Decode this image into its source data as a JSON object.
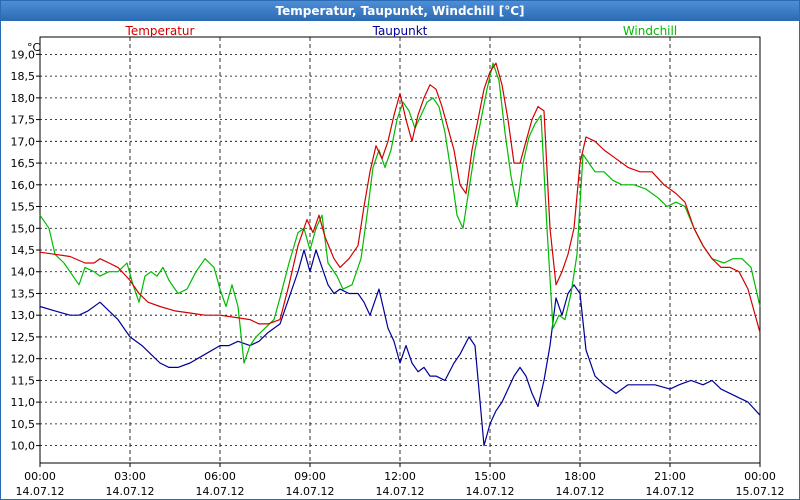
{
  "window": {
    "title": "Temperatur, Taupunkt, Windchill [°C]"
  },
  "chart_data": {
    "type": "line",
    "title": "Temperatur, Taupunkt, Windchill [°C]",
    "ylabel": "°C",
    "xlabel": "",
    "ylim": [
      9.6,
      19.4
    ],
    "xlim": [
      0,
      24
    ],
    "grid": true,
    "legend_position": "top",
    "y_ticks": [
      "10,0",
      "10,5",
      "11,0",
      "11,5",
      "12,0",
      "12,5",
      "13,0",
      "13,5",
      "14,0",
      "14,5",
      "15,0",
      "15,5",
      "16,0",
      "16,5",
      "17,0",
      "17,5",
      "18,0",
      "18,5",
      "19,0"
    ],
    "x_ticks": [
      {
        "time": "00:00",
        "date": "14.07.12"
      },
      {
        "time": "03:00",
        "date": "14.07.12"
      },
      {
        "time": "06:00",
        "date": "14.07.12"
      },
      {
        "time": "09:00",
        "date": "14.07.12"
      },
      {
        "time": "12:00",
        "date": "14.07.12"
      },
      {
        "time": "15:00",
        "date": "14.07.12"
      },
      {
        "time": "18:00",
        "date": "14.07.12"
      },
      {
        "time": "21:00",
        "date": "14.07.12"
      },
      {
        "time": "00:00",
        "date": "15.07.12"
      }
    ],
    "x_unit_note": "x values are hours since 14.07.12 00:00",
    "series": [
      {
        "name": "Temperatur",
        "color": "#d40000",
        "points": [
          [
            0,
            14.45
          ],
          [
            0.5,
            14.4
          ],
          [
            1,
            14.35
          ],
          [
            1.5,
            14.2
          ],
          [
            1.8,
            14.2
          ],
          [
            2,
            14.3
          ],
          [
            2.3,
            14.2
          ],
          [
            2.6,
            14.1
          ],
          [
            3,
            13.8
          ],
          [
            3.3,
            13.5
          ],
          [
            3.6,
            13.3
          ],
          [
            4,
            13.2
          ],
          [
            4.5,
            13.1
          ],
          [
            5,
            13.05
          ],
          [
            5.5,
            13.0
          ],
          [
            6,
            13.0
          ],
          [
            6.5,
            12.95
          ],
          [
            7,
            12.9
          ],
          [
            7.3,
            12.8
          ],
          [
            7.6,
            12.8
          ],
          [
            8,
            12.9
          ],
          [
            8.3,
            13.7
          ],
          [
            8.6,
            14.6
          ],
          [
            8.9,
            15.2
          ],
          [
            9.1,
            14.9
          ],
          [
            9.3,
            15.3
          ],
          [
            9.5,
            14.8
          ],
          [
            9.8,
            14.3
          ],
          [
            10,
            14.1
          ],
          [
            10.3,
            14.3
          ],
          [
            10.6,
            14.6
          ],
          [
            10.8,
            15.5
          ],
          [
            11,
            16.3
          ],
          [
            11.2,
            16.9
          ],
          [
            11.4,
            16.6
          ],
          [
            11.6,
            17.0
          ],
          [
            11.8,
            17.6
          ],
          [
            12,
            18.1
          ],
          [
            12.2,
            17.5
          ],
          [
            12.4,
            17.0
          ],
          [
            12.6,
            17.6
          ],
          [
            12.8,
            18.0
          ],
          [
            13,
            18.3
          ],
          [
            13.2,
            18.2
          ],
          [
            13.4,
            17.8
          ],
          [
            13.6,
            17.3
          ],
          [
            13.8,
            16.8
          ],
          [
            14,
            16.0
          ],
          [
            14.2,
            15.8
          ],
          [
            14.4,
            16.8
          ],
          [
            14.6,
            17.5
          ],
          [
            14.8,
            18.2
          ],
          [
            15,
            18.6
          ],
          [
            15.2,
            18.8
          ],
          [
            15.4,
            18.3
          ],
          [
            15.6,
            17.5
          ],
          [
            15.8,
            16.5
          ],
          [
            16,
            16.5
          ],
          [
            16.2,
            17.0
          ],
          [
            16.4,
            17.5
          ],
          [
            16.6,
            17.8
          ],
          [
            16.8,
            17.7
          ],
          [
            17,
            15.0
          ],
          [
            17.2,
            13.7
          ],
          [
            17.4,
            14.0
          ],
          [
            17.6,
            14.4
          ],
          [
            17.8,
            15.0
          ],
          [
            18,
            16.5
          ],
          [
            18.2,
            17.1
          ],
          [
            18.5,
            17.0
          ],
          [
            18.8,
            16.8
          ],
          [
            19.2,
            16.6
          ],
          [
            19.6,
            16.4
          ],
          [
            20,
            16.3
          ],
          [
            20.4,
            16.3
          ],
          [
            20.8,
            16.0
          ],
          [
            21.2,
            15.8
          ],
          [
            21.5,
            15.6
          ],
          [
            21.8,
            15.0
          ],
          [
            22.1,
            14.6
          ],
          [
            22.4,
            14.3
          ],
          [
            22.7,
            14.1
          ],
          [
            23,
            14.1
          ],
          [
            23.3,
            14.0
          ],
          [
            23.6,
            13.6
          ],
          [
            23.8,
            13.1
          ],
          [
            24,
            12.6
          ]
        ]
      },
      {
        "name": "Taupunkt",
        "color": "#000099",
        "points": [
          [
            0,
            13.2
          ],
          [
            0.5,
            13.1
          ],
          [
            1,
            13.0
          ],
          [
            1.3,
            13.0
          ],
          [
            1.6,
            13.1
          ],
          [
            2,
            13.3
          ],
          [
            2.3,
            13.1
          ],
          [
            2.6,
            12.9
          ],
          [
            3,
            12.5
          ],
          [
            3.4,
            12.3
          ],
          [
            3.7,
            12.1
          ],
          [
            4,
            11.9
          ],
          [
            4.3,
            11.8
          ],
          [
            4.6,
            11.8
          ],
          [
            5,
            11.9
          ],
          [
            5.5,
            12.1
          ],
          [
            6,
            12.3
          ],
          [
            6.3,
            12.3
          ],
          [
            6.6,
            12.4
          ],
          [
            7,
            12.3
          ],
          [
            7.3,
            12.4
          ],
          [
            7.6,
            12.6
          ],
          [
            8,
            12.8
          ],
          [
            8.3,
            13.4
          ],
          [
            8.6,
            14.0
          ],
          [
            8.8,
            14.5
          ],
          [
            9,
            14.0
          ],
          [
            9.2,
            14.5
          ],
          [
            9.4,
            14.1
          ],
          [
            9.6,
            13.7
          ],
          [
            9.8,
            13.5
          ],
          [
            10,
            13.6
          ],
          [
            10.3,
            13.5
          ],
          [
            10.6,
            13.5
          ],
          [
            10.8,
            13.3
          ],
          [
            11,
            13.0
          ],
          [
            11.3,
            13.6
          ],
          [
            11.6,
            12.7
          ],
          [
            11.8,
            12.4
          ],
          [
            12,
            11.9
          ],
          [
            12.2,
            12.3
          ],
          [
            12.4,
            11.9
          ],
          [
            12.6,
            11.7
          ],
          [
            12.8,
            11.8
          ],
          [
            13,
            11.6
          ],
          [
            13.2,
            11.6
          ],
          [
            13.5,
            11.5
          ],
          [
            13.8,
            11.9
          ],
          [
            14,
            12.1
          ],
          [
            14.3,
            12.5
          ],
          [
            14.5,
            12.3
          ],
          [
            14.8,
            10.0
          ],
          [
            15,
            10.5
          ],
          [
            15.2,
            10.8
          ],
          [
            15.4,
            11.0
          ],
          [
            15.6,
            11.3
          ],
          [
            15.8,
            11.6
          ],
          [
            16,
            11.8
          ],
          [
            16.2,
            11.6
          ],
          [
            16.4,
            11.2
          ],
          [
            16.6,
            10.9
          ],
          [
            16.8,
            11.5
          ],
          [
            17,
            12.3
          ],
          [
            17.2,
            13.4
          ],
          [
            17.4,
            13.0
          ],
          [
            17.6,
            13.5
          ],
          [
            17.8,
            13.7
          ],
          [
            18,
            13.5
          ],
          [
            18.2,
            12.2
          ],
          [
            18.5,
            11.6
          ],
          [
            18.8,
            11.4
          ],
          [
            19.2,
            11.2
          ],
          [
            19.6,
            11.4
          ],
          [
            20,
            11.4
          ],
          [
            20.5,
            11.4
          ],
          [
            21,
            11.3
          ],
          [
            21.3,
            11.4
          ],
          [
            21.7,
            11.5
          ],
          [
            22.1,
            11.4
          ],
          [
            22.4,
            11.5
          ],
          [
            22.7,
            11.3
          ],
          [
            23,
            11.2
          ],
          [
            23.3,
            11.1
          ],
          [
            23.6,
            11.0
          ],
          [
            24,
            10.7
          ]
        ]
      },
      {
        "name": "Windchill",
        "color": "#00bb00",
        "points": [
          [
            0,
            15.3
          ],
          [
            0.3,
            15.0
          ],
          [
            0.5,
            14.4
          ],
          [
            0.8,
            14.2
          ],
          [
            1,
            14.0
          ],
          [
            1.3,
            13.7
          ],
          [
            1.5,
            14.1
          ],
          [
            1.8,
            14.0
          ],
          [
            2,
            13.9
          ],
          [
            2.3,
            14.0
          ],
          [
            2.6,
            14.0
          ],
          [
            2.9,
            14.2
          ],
          [
            3.1,
            13.7
          ],
          [
            3.3,
            13.3
          ],
          [
            3.5,
            13.9
          ],
          [
            3.7,
            14.0
          ],
          [
            3.9,
            13.9
          ],
          [
            4.1,
            14.1
          ],
          [
            4.3,
            13.8
          ],
          [
            4.6,
            13.5
          ],
          [
            4.9,
            13.6
          ],
          [
            5.2,
            14.0
          ],
          [
            5.5,
            14.3
          ],
          [
            5.8,
            14.1
          ],
          [
            6,
            13.6
          ],
          [
            6.2,
            13.2
          ],
          [
            6.4,
            13.7
          ],
          [
            6.6,
            13.2
          ],
          [
            6.8,
            11.9
          ],
          [
            7,
            12.3
          ],
          [
            7.2,
            12.5
          ],
          [
            7.5,
            12.7
          ],
          [
            7.8,
            12.9
          ],
          [
            8,
            13.4
          ],
          [
            8.3,
            14.2
          ],
          [
            8.6,
            14.9
          ],
          [
            8.8,
            15.0
          ],
          [
            9,
            14.5
          ],
          [
            9.2,
            15.0
          ],
          [
            9.4,
            15.3
          ],
          [
            9.6,
            14.2
          ],
          [
            9.9,
            13.9
          ],
          [
            10.1,
            13.6
          ],
          [
            10.4,
            13.7
          ],
          [
            10.7,
            14.3
          ],
          [
            10.9,
            15.3
          ],
          [
            11.1,
            16.4
          ],
          [
            11.3,
            16.8
          ],
          [
            11.5,
            16.4
          ],
          [
            11.7,
            16.8
          ],
          [
            11.9,
            17.5
          ],
          [
            12.1,
            17.9
          ],
          [
            12.3,
            17.7
          ],
          [
            12.5,
            17.3
          ],
          [
            12.7,
            17.6
          ],
          [
            12.9,
            17.9
          ],
          [
            13.1,
            18.0
          ],
          [
            13.3,
            17.8
          ],
          [
            13.5,
            17.2
          ],
          [
            13.7,
            16.3
          ],
          [
            13.9,
            15.3
          ],
          [
            14.1,
            15.0
          ],
          [
            14.3,
            15.9
          ],
          [
            14.5,
            16.8
          ],
          [
            14.7,
            17.5
          ],
          [
            14.9,
            18.2
          ],
          [
            15.1,
            18.8
          ],
          [
            15.3,
            18.4
          ],
          [
            15.5,
            17.2
          ],
          [
            15.7,
            16.2
          ],
          [
            15.9,
            15.5
          ],
          [
            16.1,
            16.5
          ],
          [
            16.3,
            17.1
          ],
          [
            16.5,
            17.4
          ],
          [
            16.7,
            17.6
          ],
          [
            16.9,
            15.0
          ],
          [
            17.1,
            12.7
          ],
          [
            17.3,
            13.0
          ],
          [
            17.5,
            12.9
          ],
          [
            17.7,
            13.5
          ],
          [
            17.9,
            14.4
          ],
          [
            18.1,
            16.7
          ],
          [
            18.3,
            16.5
          ],
          [
            18.5,
            16.3
          ],
          [
            18.8,
            16.3
          ],
          [
            19.1,
            16.1
          ],
          [
            19.4,
            16.0
          ],
          [
            19.8,
            16.0
          ],
          [
            20.2,
            15.9
          ],
          [
            20.6,
            15.7
          ],
          [
            20.9,
            15.5
          ],
          [
            21.2,
            15.6
          ],
          [
            21.5,
            15.5
          ],
          [
            21.8,
            15.0
          ],
          [
            22.1,
            14.6
          ],
          [
            22.4,
            14.3
          ],
          [
            22.8,
            14.2
          ],
          [
            23.1,
            14.3
          ],
          [
            23.4,
            14.3
          ],
          [
            23.7,
            14.1
          ],
          [
            24,
            13.2
          ]
        ]
      }
    ]
  }
}
